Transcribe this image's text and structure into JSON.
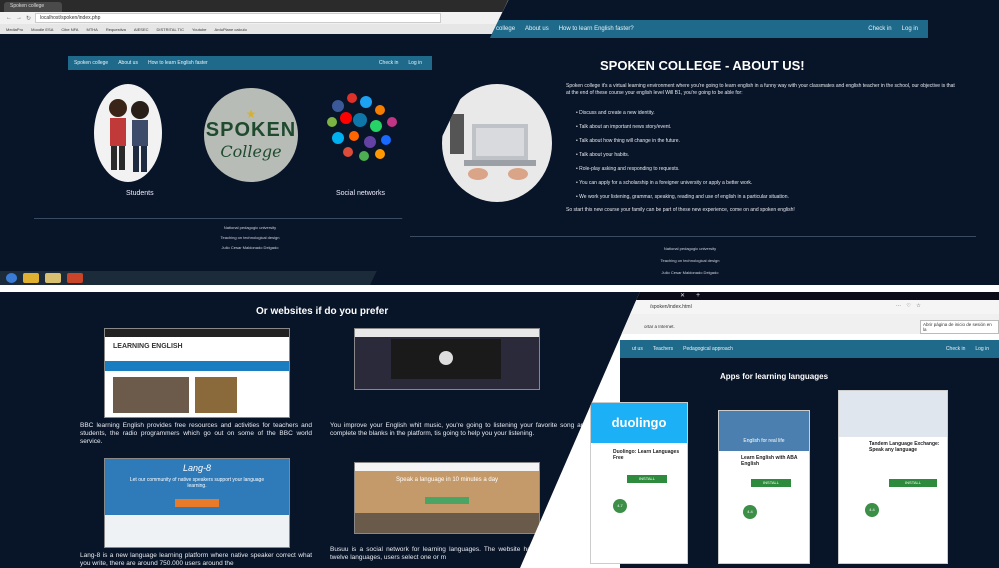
{
  "panel1": {
    "tab_title": "Spoken college",
    "address": "localhost/spoken/index.php",
    "bookmarks": [
      "MediaPro",
      "Moodle ESA",
      "Cibe NFA",
      "MTHA",
      "Requestiva",
      "AIESEC",
      "DISTRITAL TIC",
      "Youtube",
      "ArduPlane calculo"
    ],
    "nav": {
      "brand": "Spoken college",
      "about": "About us",
      "learn": "How to learn English faster",
      "checkin": "Check in",
      "login": "Log in"
    },
    "logo": {
      "line1": "SPOKEN",
      "line2": "College"
    },
    "captions": {
      "students": "Students",
      "social": "Social networks"
    },
    "footer": [
      "National pedagogic university",
      "Teaching on technological design",
      "Julio Cesar Maldonado Delgado"
    ]
  },
  "panel2": {
    "nav": {
      "brand": "Spoken college",
      "about": "About us",
      "learn": "How to learn English faster?",
      "checkin": "Check in",
      "login": "Log in"
    },
    "title": "SPOKEN COLLEGE - ABOUT US!",
    "intro": "Spoken college it's a virtual learning environment where you're going to learn english in a funny way with your classmates and english teacher in the school, our objective is that at the end of these course your english level Will B1, you're going to be able for:",
    "bullets": [
      "Discuss and create a new identity.",
      "Talk about an important news story/event.",
      "Talk about how thing will change in the future.",
      "Talk about your habits.",
      "Role-play asking and responding to requests.",
      "You can apply for a scholarship in a foreigner university or apply a better work.",
      "We work your listening, grammar, speaking, reading and use of english in a particular situation."
    ],
    "closing": "So start this new course your family can be part of these new experience, come on and spoken english!",
    "footer": [
      "National pedagogic university",
      "Teaching on technological design",
      "Julio Cesar Maldonado Delgado"
    ]
  },
  "panel3": {
    "title": "Or websites if do you prefer",
    "bbc_header": "LEARNING ENGLISH",
    "bbc": "BBC learning English provides free resources and activities for teachers and students, the radio programmers which go out on some of the BBC world service.",
    "lyrics": "You improve your English whit music, you're going to listening your favorite song and complete the blanks in the platform, tis going to help you your listening.",
    "lang8_title": "Lang-8",
    "lang8_sub": "Let our community of native speakers support your language learning.",
    "lang8": "Lang-8 is a new language learning platform where native speaker correct what you write, there are around 750.000 users around the",
    "busuu_banner": "Speak a language in 10 minutes a day",
    "busuu": "Busuu is a social network for learning languages. The website has learning units for twelve languages, users select one or m"
  },
  "panel4": {
    "address": "/spoken/index.html",
    "bookmark_hint": "Abrir página de inicio de sesión en la",
    "importar": "ortar a Internet.",
    "nav": {
      "us": "ut us",
      "teachers": "Teachers",
      "ped": "Pedagogical approach",
      "checkin": "Check in",
      "login": "Log in"
    },
    "title": "Apps for learning languages",
    "apps": [
      {
        "name": "Duolingo: Learn Languages Free",
        "brand": "duolingo",
        "rating": "4.7",
        "install": "INSTALL"
      },
      {
        "name": "Learn English with ABA English",
        "banner": "English for real life",
        "rating": "4.4",
        "install": "INSTALL"
      },
      {
        "name": "Tandem Language Exchange: Speak any language",
        "rating": "4.4",
        "install": "INSTALL"
      }
    ]
  },
  "colors": {
    "bg": "#081428",
    "nav": "#1f6a8a",
    "install": "#2e8b3e"
  }
}
